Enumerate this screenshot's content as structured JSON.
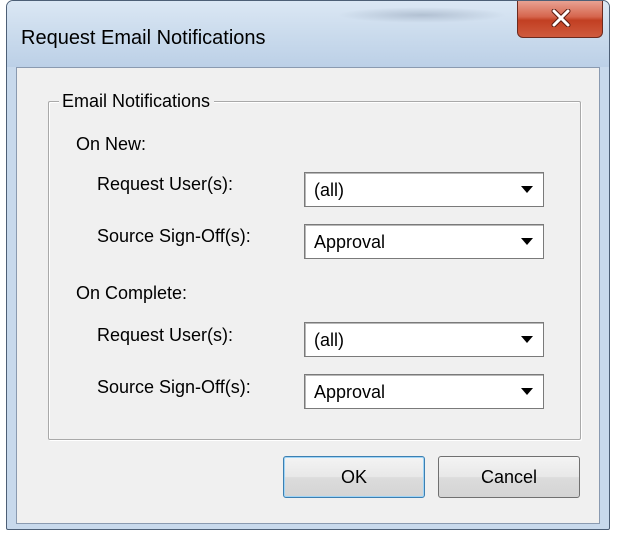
{
  "window": {
    "title": "Request Email Notifications"
  },
  "icons": {
    "close": "close-x-icon",
    "dropdown": "chevron-down-icon"
  },
  "group": {
    "legend": "Email Notifications"
  },
  "on_new": {
    "heading": "On New:",
    "request_users_label": "Request User(s):",
    "request_users_value": "(all)",
    "source_signoffs_label": "Source Sign-Off(s):",
    "source_signoffs_value": "Approval"
  },
  "on_complete": {
    "heading": "On Complete:",
    "request_users_label": "Request User(s):",
    "request_users_value": "(all)",
    "source_signoffs_label": "Source Sign-Off(s):",
    "source_signoffs_value": "Approval"
  },
  "buttons": {
    "ok": "OK",
    "cancel": "Cancel"
  },
  "colors": {
    "close_button": "#c94a30",
    "dialog_face": "#f0f0f0",
    "frame": "#c8d9ec"
  }
}
